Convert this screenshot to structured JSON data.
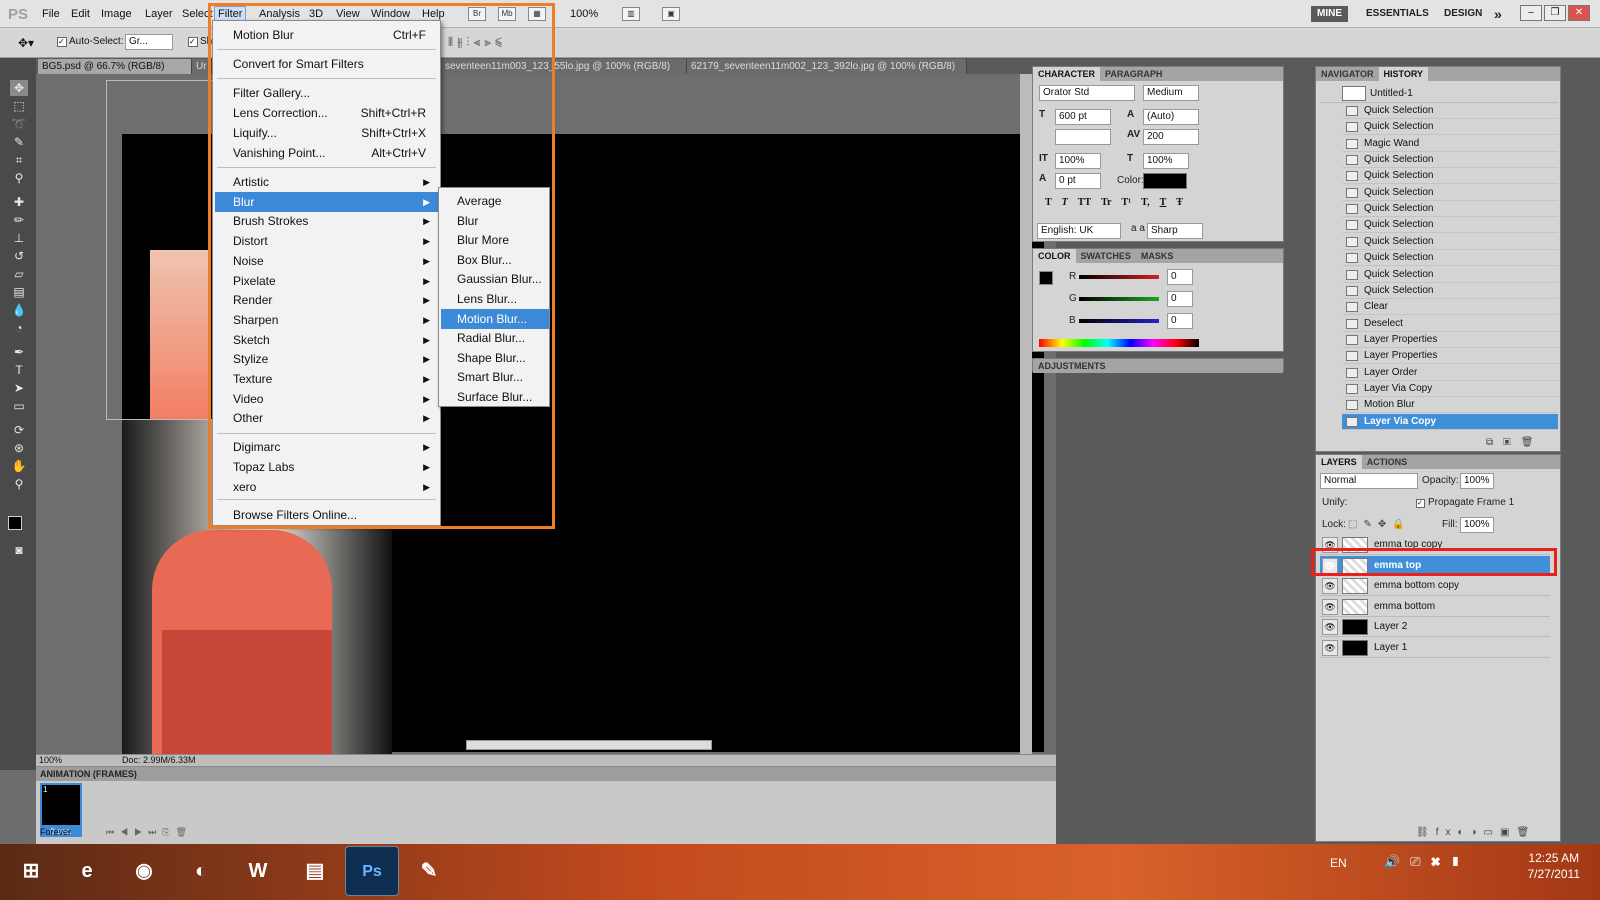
{
  "menubar": {
    "logo": "PS",
    "items": [
      "File",
      "Edit",
      "Image",
      "Layer",
      "Select",
      "Filter",
      "Analysis",
      "3D",
      "View",
      "Window",
      "Help"
    ],
    "icons": [
      "Br",
      "Mb"
    ],
    "zoom": "100%",
    "workspaces": [
      "MINE",
      "ESSENTIALS",
      "DESIGN"
    ],
    "more": "»"
  },
  "options": {
    "auto_select_label": "Auto-Select:",
    "auto_select_value": "Gr...",
    "show_label": "Sho"
  },
  "doc_tabs": [
    "BG5.psd @ 66.7% (RGB/8)",
    "Ur",
    "seventeen11m003_123_55lo.jpg @ 100% (RGB/8)",
    "62179_seventeen11m002_123_392lo.jpg @ 100% (RGB/8)"
  ],
  "filter_menu": {
    "last_filter": {
      "label": "Motion Blur",
      "shortcut": "Ctrl+F"
    },
    "convert": "Convert for Smart Filters",
    "group1": [
      {
        "label": "Filter Gallery...",
        "shortcut": ""
      },
      {
        "label": "Lens Correction...",
        "shortcut": "Shift+Ctrl+R"
      },
      {
        "label": "Liquify...",
        "shortcut": "Shift+Ctrl+X"
      },
      {
        "label": "Vanishing Point...",
        "shortcut": "Alt+Ctrl+V"
      }
    ],
    "submenus": [
      "Artistic",
      "Blur",
      "Brush Strokes",
      "Distort",
      "Noise",
      "Pixelate",
      "Render",
      "Sharpen",
      "Sketch",
      "Stylize",
      "Texture",
      "Video",
      "Other"
    ],
    "plugins": [
      "Digimarc",
      "Topaz Labs",
      "xero"
    ],
    "browse": "Browse Filters Online..."
  },
  "blur_menu": [
    "Average",
    "Blur",
    "Blur More",
    "Box Blur...",
    "Gaussian Blur...",
    "Lens Blur...",
    "Motion Blur...",
    "Radial Blur...",
    "Shape Blur...",
    "Smart Blur...",
    "Surface Blur..."
  ],
  "statusbar": {
    "zoom": "100%",
    "doc": "Doc: 2.99M/6.33M"
  },
  "animation": {
    "title": "ANIMATION (FRAMES)",
    "frame_number": "1",
    "frame_time": "0 sec.",
    "loop": "Forever"
  },
  "character": {
    "tabs": [
      "CHARACTER",
      "PARAGRAPH"
    ],
    "font": "Orator Std",
    "style": "Medium",
    "size": "600 pt",
    "leading": "(Auto)",
    "tracking": "200",
    "vscale": "100%",
    "hscale": "100%",
    "baseline": "0 pt",
    "color_label": "Color:",
    "language": "English: UK",
    "aa_label": "a a",
    "antialias": "Sharp",
    "type_buttons": [
      "T",
      "T",
      "TT",
      "Tr",
      "T¹",
      "T,",
      "T",
      "Ŧ"
    ]
  },
  "color_panel": {
    "tabs": [
      "COLOR",
      "SWATCHES",
      "MASKS"
    ],
    "channels": [
      {
        "label": "R",
        "value": "0",
        "color": "#d42020"
      },
      {
        "label": "G",
        "value": "0",
        "color": "#1fa51f"
      },
      {
        "label": "B",
        "value": "0",
        "color": "#2323c8"
      }
    ]
  },
  "adjustments": {
    "title": "ADJUSTMENTS"
  },
  "history": {
    "tabs": [
      "NAVIGATOR",
      "HISTORY"
    ],
    "snapshot": "Untitled-1",
    "states": [
      "Quick Selection",
      "Quick Selection",
      "Magic Wand",
      "Quick Selection",
      "Quick Selection",
      "Quick Selection",
      "Quick Selection",
      "Quick Selection",
      "Quick Selection",
      "Quick Selection",
      "Quick Selection",
      "Quick Selection",
      "Clear",
      "Deselect",
      "Layer Properties",
      "Layer Properties",
      "Layer Order",
      "Layer Via Copy",
      "Motion Blur",
      "Layer Via Copy"
    ]
  },
  "layers": {
    "tabs": [
      "LAYERS",
      "ACTIONS"
    ],
    "blend_mode": "Normal",
    "opacity_label": "Opacity:",
    "opacity": "100%",
    "unify_label": "Unify:",
    "propagate": "Propagate Frame 1",
    "lock_label": "Lock:",
    "fill_label": "Fill:",
    "fill": "100%",
    "items": [
      {
        "name": "emma top copy",
        "selected": false
      },
      {
        "name": "emma top",
        "selected": true
      },
      {
        "name": "emma bottom copy",
        "selected": false
      },
      {
        "name": "emma bottom",
        "selected": false
      },
      {
        "name": "Layer 2",
        "selected": false
      },
      {
        "name": "Layer 1",
        "selected": false
      }
    ]
  },
  "taskbar": {
    "apps": [
      "start-orb",
      "internet-explorer",
      "chrome",
      "firefox",
      "word",
      "explorer",
      "photoshop",
      "paint"
    ],
    "app_glyphs": [
      "⊞",
      "e",
      "◉",
      "◐",
      "W",
      "▤",
      "Ps",
      "✎"
    ],
    "lang": "EN",
    "time": "12:25 AM",
    "date": "7/27/2011"
  }
}
